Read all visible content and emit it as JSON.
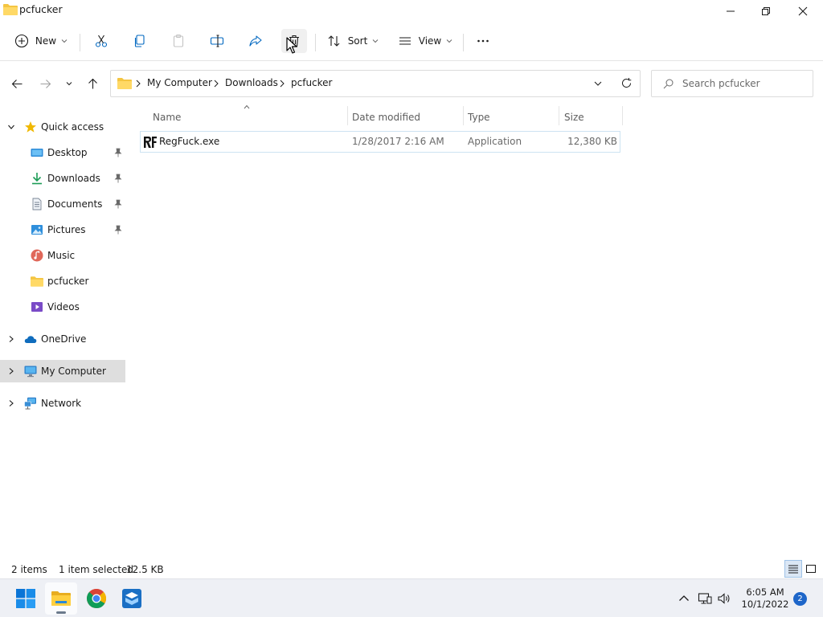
{
  "window": {
    "title": "pcfucker"
  },
  "toolbar": {
    "new_label": "New",
    "sort_label": "Sort",
    "view_label": "View"
  },
  "address": {
    "crumbs": [
      "My Computer",
      "Downloads",
      "pcfucker"
    ]
  },
  "search": {
    "placeholder": "Search pcfucker"
  },
  "nav": {
    "quick_access": "Quick access",
    "items": [
      {
        "label": "Desktop",
        "icon": "desktop-icon",
        "pinned": true
      },
      {
        "label": "Downloads",
        "icon": "downloads-icon",
        "pinned": true
      },
      {
        "label": "Documents",
        "icon": "documents-icon",
        "pinned": true
      },
      {
        "label": "Pictures",
        "icon": "pictures-icon",
        "pinned": true
      },
      {
        "label": "Music",
        "icon": "music-icon",
        "pinned": false
      },
      {
        "label": "pcfucker",
        "icon": "folder-icon",
        "pinned": false
      },
      {
        "label": "Videos",
        "icon": "videos-icon",
        "pinned": false
      }
    ],
    "onedrive": "OneDrive",
    "my_computer": "My Computer",
    "network": "Network"
  },
  "list": {
    "columns": [
      "Name",
      "Date modified",
      "Type",
      "Size"
    ],
    "rows": [
      {
        "name": "RegFuck.exe",
        "date": "1/28/2017 2:16 AM",
        "type": "Application",
        "size": "12,380 KB",
        "selected": true
      }
    ]
  },
  "status": {
    "count": "2 items",
    "selection": "1 item selected",
    "size": "12.5 KB"
  },
  "taskbar": {
    "time": "6:05 AM",
    "date": "10/1/2022",
    "notifications": "2"
  },
  "colors": {
    "accent": "#0067c0",
    "folder": "#f4c542",
    "selected_row_border": "#cde3f2",
    "nav_selected": "#dedede"
  }
}
